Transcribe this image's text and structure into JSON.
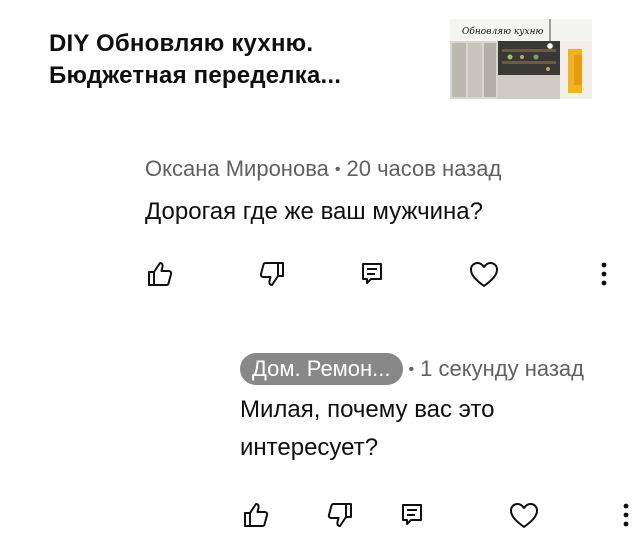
{
  "video": {
    "title_line1": "DIY Обновляю кухню.",
    "title_line2": "Бюджетная переделка...",
    "thumbnail_text": "Обновляю кухню"
  },
  "comments": [
    {
      "author": "Оксана Миронова",
      "separator": "•",
      "time": "20 часов назад",
      "text": "Дорогая где же ваш мужчина?"
    },
    {
      "author": "Дом. Ремон...",
      "separator": "•",
      "time": "1 секунду назад",
      "text_line1": "Милая, почему вас это",
      "text_line2": "интересует?"
    }
  ],
  "icons": {
    "like": "thumbs-up-icon",
    "dislike": "thumbs-down-icon",
    "reply": "comment-reply-icon",
    "heart": "heart-icon",
    "more": "more-vertical-icon"
  },
  "colors": {
    "text": "#0f0f0f",
    "secondary": "#606060",
    "author_pill": "#888888"
  }
}
